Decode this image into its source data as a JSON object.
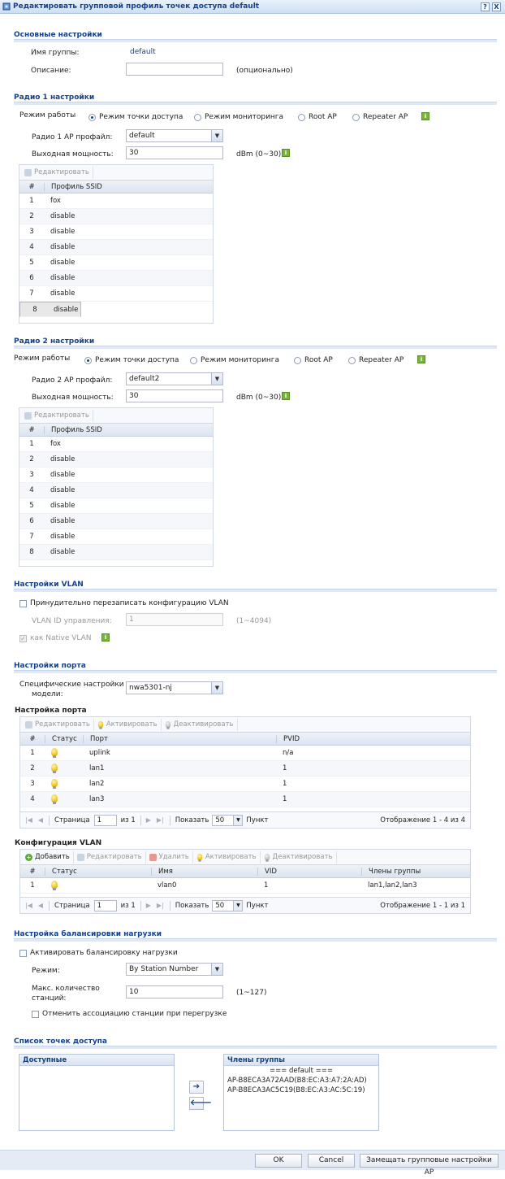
{
  "window": {
    "title": "Редактировать групповой профиль точек доступа default",
    "help": "?",
    "close": "X"
  },
  "basic": {
    "title": "Основные настройки",
    "group_label": "Имя группы:",
    "group_value": "default",
    "desc_label": "Описание:",
    "desc_value": "",
    "desc_hint": "(опционально)"
  },
  "radio1": {
    "title": "Радио 1 настройки",
    "mode_label": "Режим работы",
    "modes": [
      "Режим точки доступа",
      "Режим мониторинга",
      "Root AP",
      "Repeater AP"
    ],
    "selected_mode": 0,
    "profile_label": "Радио 1 AP профайл:",
    "profile_value": "default",
    "power_label": "Выходная мощность:",
    "power_value": "30",
    "power_unit": "dBm (0~30)",
    "edit_label": "Редактировать",
    "col_num": "#",
    "col_ssid": "Профиль SSID",
    "rows": [
      {
        "n": "1",
        "v": "fox"
      },
      {
        "n": "2",
        "v": "disable"
      },
      {
        "n": "3",
        "v": "disable"
      },
      {
        "n": "4",
        "v": "disable"
      },
      {
        "n": "5",
        "v": "disable"
      },
      {
        "n": "6",
        "v": "disable"
      },
      {
        "n": "7",
        "v": "disable"
      },
      {
        "n": "8",
        "v": "disable"
      }
    ]
  },
  "radio2": {
    "title": "Радио 2 настройки",
    "mode_label": "Режим работы",
    "modes": [
      "Режим точки доступа",
      "Режим мониторинга",
      "Root AP",
      "Repeater AP"
    ],
    "selected_mode": 0,
    "profile_label": "Радио 2 AP профайл:",
    "profile_value": "default2",
    "power_label": "Выходная мощность:",
    "power_value": "30",
    "power_unit": "dBm (0~30)",
    "edit_label": "Редактировать",
    "col_num": "#",
    "col_ssid": "Профиль SSID",
    "rows": [
      {
        "n": "1",
        "v": "fox"
      },
      {
        "n": "2",
        "v": "disable"
      },
      {
        "n": "3",
        "v": "disable"
      },
      {
        "n": "4",
        "v": "disable"
      },
      {
        "n": "5",
        "v": "disable"
      },
      {
        "n": "6",
        "v": "disable"
      },
      {
        "n": "7",
        "v": "disable"
      },
      {
        "n": "8",
        "v": "disable"
      }
    ]
  },
  "vlan": {
    "title": "Настройки VLAN",
    "force_label": "Принудительно перезаписать конфигурацию VLAN",
    "id_label": "VLAN ID управления:",
    "id_value": "1",
    "id_range": "(1~4094)",
    "native_label": "как Native VLAN"
  },
  "port": {
    "title": "Настройки порта",
    "model_label_1": "Специфические настройки",
    "model_label_2": "модели:",
    "model_value": "nwa5301-nj",
    "port_cfg_title": "Настройка порта",
    "btn_edit": "Редактировать",
    "btn_activate": "Активировать",
    "btn_deactivate": "Деактивировать",
    "cols": [
      "#",
      "Статус",
      "Порт",
      "PVID"
    ],
    "rows": [
      {
        "n": "1",
        "port": "uplink",
        "pvid": "n/a"
      },
      {
        "n": "2",
        "port": "lan1",
        "pvid": "1"
      },
      {
        "n": "3",
        "port": "lan2",
        "pvid": "1"
      },
      {
        "n": "4",
        "port": "lan3",
        "pvid": "1"
      }
    ],
    "pager": {
      "page_label": "Страница",
      "page_value": "1",
      "of_label": "из 1",
      "show_label": "Показать",
      "show_value": "50",
      "unit_label": "Пункт",
      "display": "Отображение 1 - 4 из 4"
    },
    "vlan_cfg_title": "Конфигурация VLAN",
    "btn_add": "Добавить",
    "btn_delete": "Удалить",
    "vcols": [
      "#",
      "Статус",
      "Имя",
      "VID",
      "Члены группы"
    ],
    "vrows": [
      {
        "n": "1",
        "name": "vlan0",
        "vid": "1",
        "members": "lan1,lan2,lan3"
      }
    ],
    "vpager": {
      "page_label": "Страница",
      "page_value": "1",
      "of_label": "из 1",
      "show_label": "Показать",
      "show_value": "50",
      "unit_label": "Пункт",
      "display": "Отображение 1 - 1 из 1"
    }
  },
  "lb": {
    "title": "Настройка балансировки нагрузки",
    "activate_label": "Активировать балансировку нагрузки",
    "mode_label": "Режим:",
    "mode_value": "By Station Number",
    "max_label_1": "Макс. количество",
    "max_label_2": "станций:",
    "max_value": "10",
    "max_range": "(1~127)",
    "disassoc_label": "Отменить ассоциацию станции при перегрузке"
  },
  "aplist": {
    "title": "Список точек доступа",
    "available": "Доступные",
    "members": "Члены группы",
    "members_header": "=== default ===",
    "items": [
      "AP-B8ECA3A72AAD(B8:EC:A3:A7:2A:AD)",
      "AP-B8ECA3AC5C19(B8:EC:A3:AC:5C:19)"
    ],
    "move_right": "➔",
    "move_left": "🡐"
  },
  "footer": {
    "ok": "OK",
    "cancel": "Cancel",
    "replace": "Замещать групповые настройки AP"
  },
  "colors": {
    "title_blue": "#15428b",
    "info_green": "#7ab43b"
  },
  "icons": [
    "edit-icon",
    "info-icon",
    "bulb-icon",
    "add-icon",
    "delete-icon",
    "arrow-right-icon",
    "arrow-left-icon"
  ]
}
